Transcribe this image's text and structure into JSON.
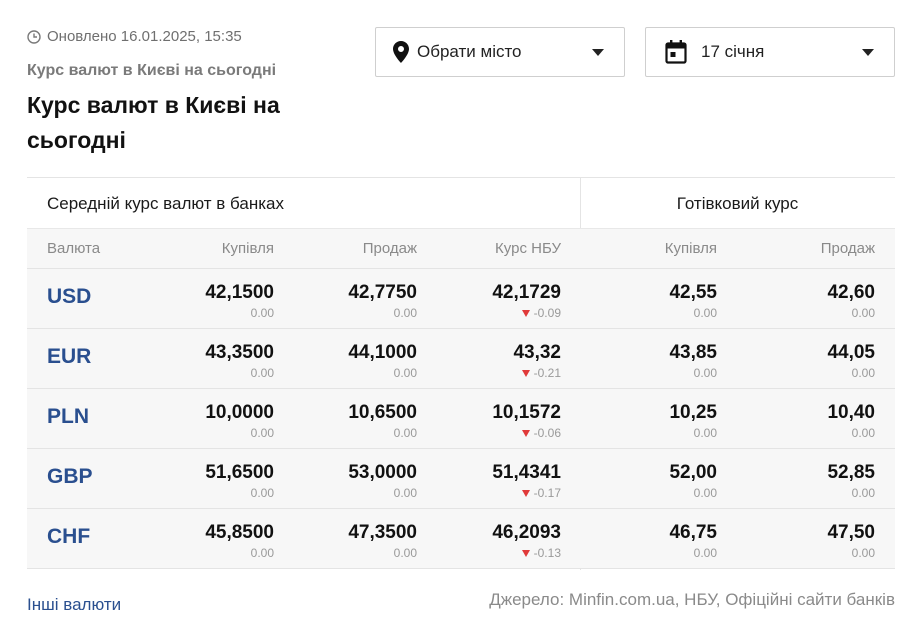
{
  "header": {
    "updated": "Оновлено 16.01.2025, 15:35",
    "breadcrumb": "Курс валют в Києві на сьогодні",
    "title": "Курс валют в Києві на сьогодні"
  },
  "filters": {
    "city_label": "Обрати місто",
    "date_label": "17 січня"
  },
  "table": {
    "avg_header": "Середній курс валют в банках",
    "cash_header": "Готівковий курс",
    "columns": [
      "Валюта",
      "Купівля",
      "Продаж",
      "Курс НБУ",
      "Купівля",
      "Продаж"
    ],
    "rows": [
      {
        "code": "USD",
        "buy": "42,1500",
        "buy_d": "0.00",
        "sell": "42,7750",
        "sell_d": "0.00",
        "nbu": "42,1729",
        "nbu_d": "-0.09",
        "cash_buy": "42,55",
        "cash_buy_d": "0.00",
        "cash_sell": "42,60",
        "cash_sell_d": "0.00"
      },
      {
        "code": "EUR",
        "buy": "43,3500",
        "buy_d": "0.00",
        "sell": "44,1000",
        "sell_d": "0.00",
        "nbu": "43,32",
        "nbu_d": "-0.21",
        "cash_buy": "43,85",
        "cash_buy_d": "0.00",
        "cash_sell": "44,05",
        "cash_sell_d": "0.00"
      },
      {
        "code": "PLN",
        "buy": "10,0000",
        "buy_d": "0.00",
        "sell": "10,6500",
        "sell_d": "0.00",
        "nbu": "10,1572",
        "nbu_d": "-0.06",
        "cash_buy": "10,25",
        "cash_buy_d": "0.00",
        "cash_sell": "10,40",
        "cash_sell_d": "0.00"
      },
      {
        "code": "GBP",
        "buy": "51,6500",
        "buy_d": "0.00",
        "sell": "53,0000",
        "sell_d": "0.00",
        "nbu": "51,4341",
        "nbu_d": "-0.17",
        "cash_buy": "52,00",
        "cash_buy_d": "0.00",
        "cash_sell": "52,85",
        "cash_sell_d": "0.00"
      },
      {
        "code": "CHF",
        "buy": "45,8500",
        "buy_d": "0.00",
        "sell": "47,3500",
        "sell_d": "0.00",
        "nbu": "46,2093",
        "nbu_d": "-0.13",
        "cash_buy": "46,75",
        "cash_buy_d": "0.00",
        "cash_sell": "47,50",
        "cash_sell_d": "0.00"
      }
    ]
  },
  "footer": {
    "other_link": "Інші валюти",
    "source": "Джерело: Minfin.com.ua, НБУ, Офіційні сайти банків"
  },
  "colors": {
    "link": "#2a4f8f",
    "down_arrow": "#e03a3a",
    "row_bg": "#f7f7f7"
  },
  "icons": [
    "clock-icon",
    "location-pin-icon",
    "calendar-icon",
    "caret-down-icon",
    "down-arrow-icon"
  ]
}
